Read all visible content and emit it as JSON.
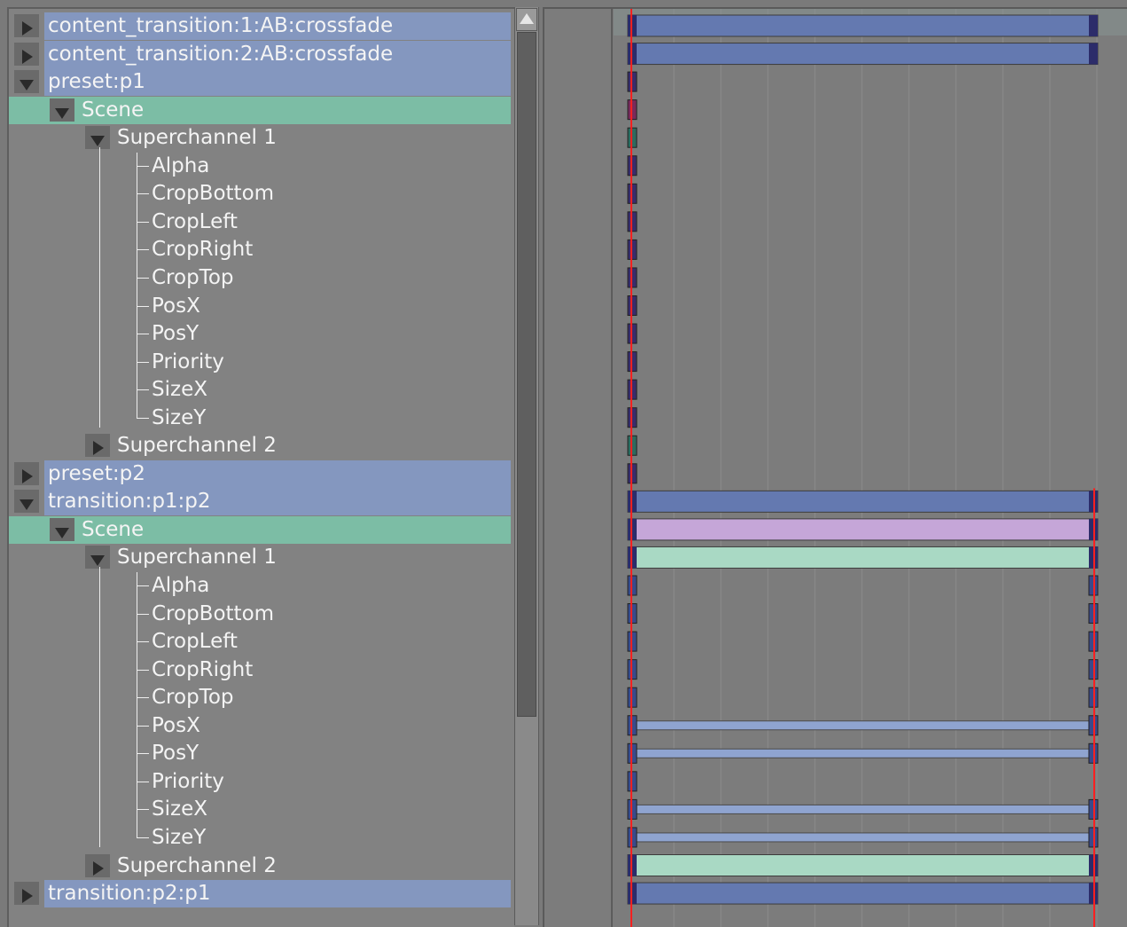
{
  "tree": {
    "rows": [
      {
        "label": "content_transition:1:AB:crossfade",
        "level": 0,
        "expander": "collapsed",
        "highlight": "blue"
      },
      {
        "label": "content_transition:2:AB:crossfade",
        "level": 0,
        "expander": "collapsed",
        "highlight": "blue"
      },
      {
        "label": "preset:p1",
        "level": 0,
        "expander": "expanded",
        "highlight": "blue"
      },
      {
        "label": "Scene",
        "level": 1,
        "expander": "expanded",
        "highlight": "green"
      },
      {
        "label": "Superchannel 1",
        "level": 2,
        "expander": "expanded",
        "highlight": "none"
      },
      {
        "label": "Alpha",
        "level": 3,
        "expander": "none",
        "highlight": "none"
      },
      {
        "label": "CropBottom",
        "level": 3,
        "expander": "none",
        "highlight": "none"
      },
      {
        "label": "CropLeft",
        "level": 3,
        "expander": "none",
        "highlight": "none"
      },
      {
        "label": "CropRight",
        "level": 3,
        "expander": "none",
        "highlight": "none"
      },
      {
        "label": "CropTop",
        "level": 3,
        "expander": "none",
        "highlight": "none"
      },
      {
        "label": "PosX",
        "level": 3,
        "expander": "none",
        "highlight": "none"
      },
      {
        "label": "PosY",
        "level": 3,
        "expander": "none",
        "highlight": "none"
      },
      {
        "label": "Priority",
        "level": 3,
        "expander": "none",
        "highlight": "none"
      },
      {
        "label": "SizeX",
        "level": 3,
        "expander": "none",
        "highlight": "none"
      },
      {
        "label": "SizeY",
        "level": 3,
        "expander": "none",
        "highlight": "none"
      },
      {
        "label": "Superchannel 2",
        "level": 2,
        "expander": "collapsed",
        "highlight": "none"
      },
      {
        "label": "preset:p2",
        "level": 0,
        "expander": "collapsed",
        "highlight": "blue"
      },
      {
        "label": "transition:p1:p2",
        "level": 0,
        "expander": "expanded",
        "highlight": "blue"
      },
      {
        "label": "Scene",
        "level": 1,
        "expander": "expanded",
        "highlight": "green"
      },
      {
        "label": "Superchannel 1",
        "level": 2,
        "expander": "expanded",
        "highlight": "none"
      },
      {
        "label": "Alpha",
        "level": 3,
        "expander": "none",
        "highlight": "none"
      },
      {
        "label": "CropBottom",
        "level": 3,
        "expander": "none",
        "highlight": "none"
      },
      {
        "label": "CropLeft",
        "level": 3,
        "expander": "none",
        "highlight": "none"
      },
      {
        "label": "CropRight",
        "level": 3,
        "expander": "none",
        "highlight": "none"
      },
      {
        "label": "CropTop",
        "level": 3,
        "expander": "none",
        "highlight": "none"
      },
      {
        "label": "PosX",
        "level": 3,
        "expander": "none",
        "highlight": "none"
      },
      {
        "label": "PosY",
        "level": 3,
        "expander": "none",
        "highlight": "none"
      },
      {
        "label": "Priority",
        "level": 3,
        "expander": "none",
        "highlight": "none"
      },
      {
        "label": "SizeX",
        "level": 3,
        "expander": "none",
        "highlight": "none"
      },
      {
        "label": "SizeY",
        "level": 3,
        "expander": "none",
        "highlight": "none"
      },
      {
        "label": "Superchannel 2",
        "level": 2,
        "expander": "collapsed",
        "highlight": "none"
      },
      {
        "label": "transition:p2:p1",
        "level": 0,
        "expander": "collapsed",
        "highlight": "blue"
      }
    ]
  },
  "timeline": {
    "tracks": [
      {
        "kind": "bar",
        "color": "#6479b0",
        "end": "full"
      },
      {
        "kind": "bar",
        "color": "#6479b0",
        "end": "full"
      },
      {
        "kind": "key",
        "color": "#3a2c6a"
      },
      {
        "kind": "key",
        "color": "#7a2a5a"
      },
      {
        "kind": "key",
        "color": "#2f6a5e"
      },
      {
        "kind": "key",
        "color": "#3a2c6a"
      },
      {
        "kind": "key",
        "color": "#3a2c6a"
      },
      {
        "kind": "key",
        "color": "#3a2c6a"
      },
      {
        "kind": "key",
        "color": "#3a2c6a"
      },
      {
        "kind": "key",
        "color": "#3a2c6a"
      },
      {
        "kind": "key",
        "color": "#3a2c6a"
      },
      {
        "kind": "key",
        "color": "#3a2c6a"
      },
      {
        "kind": "key",
        "color": "#3a2c6a"
      },
      {
        "kind": "key",
        "color": "#3a2c6a"
      },
      {
        "kind": "key",
        "color": "#3a2c6a"
      },
      {
        "kind": "key",
        "color": "#2f6a5e"
      },
      {
        "kind": "key",
        "color": "#3a2c6a"
      },
      {
        "kind": "bar",
        "color": "#6479b0",
        "end": "full"
      },
      {
        "kind": "bar",
        "color": "#c5a6d8",
        "end": "full"
      },
      {
        "kind": "bar",
        "color": "#a9d9c4",
        "end": "full"
      },
      {
        "kind": "keys",
        "color": "#3a4a8a"
      },
      {
        "kind": "keys",
        "color": "#3a4a8a"
      },
      {
        "kind": "keys",
        "color": "#3a4a8a"
      },
      {
        "kind": "keys",
        "color": "#3a4a8a"
      },
      {
        "kind": "keys",
        "color": "#3a4a8a"
      },
      {
        "kind": "thin",
        "color": "#8fa4d0"
      },
      {
        "kind": "thin",
        "color": "#8fa4d0"
      },
      {
        "kind": "key",
        "color": "#3a4a8a"
      },
      {
        "kind": "thin",
        "color": "#8fa4d0"
      },
      {
        "kind": "thin",
        "color": "#8fa4d0"
      },
      {
        "kind": "bar",
        "color": "#a9d9c4",
        "end": "full"
      },
      {
        "kind": "bar",
        "color": "#6479b0",
        "end": "full"
      }
    ],
    "playhead_color": "#ff2020",
    "grid_color": "#8c8c8c"
  }
}
